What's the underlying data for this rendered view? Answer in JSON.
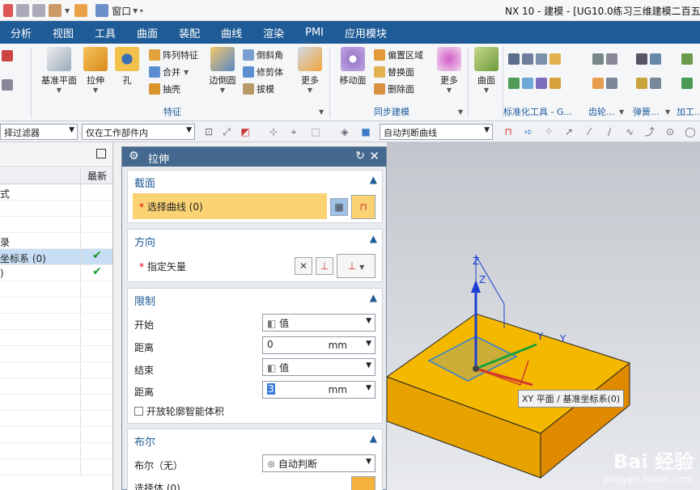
{
  "window": {
    "title": "NX 10 - 建模 - [UG10.0练习三维建模二百五"
  },
  "quick_access": {
    "window_menu": "窗口"
  },
  "menu": [
    "分析",
    "视图",
    "工具",
    "曲面",
    "装配",
    "曲线",
    "渲染",
    "PMI",
    "应用模块"
  ],
  "ribbon": {
    "datum_plane": "基准平面",
    "extrude": "拉伸",
    "hole": "孔",
    "array_feature": "阵列特征",
    "unite": "合并",
    "shell": "抽壳",
    "edge_blend": "边倒圆",
    "chamfer": "倒斜角",
    "trim_body": "修剪体",
    "draft": "拔模",
    "more1": "更多",
    "group_feature": "特征",
    "move_face": "移动面",
    "offset_region": "偏置区域",
    "replace_face": "替换面",
    "delete_face": "删除面",
    "more2": "更多",
    "group_sync": "同步建模",
    "surface": "曲面",
    "group_standard": "标准化工具 - G...",
    "group_gear": "齿轮...",
    "group_spring": "弹簧...",
    "group_machining": "加工..."
  },
  "toolbar2": {
    "filter": "择过滤器",
    "scope": "仅在工作部件内",
    "curve_rule": "自动判断曲线"
  },
  "navigator": {
    "col_latest": "最新",
    "rows": [
      {
        "label": "式",
        "check": ""
      },
      {
        "label": "",
        "check": ""
      },
      {
        "label": "",
        "check": ""
      },
      {
        "label": "录",
        "check": ""
      },
      {
        "label": "坐标系 (0)",
        "check": "✔",
        "selected": true
      },
      {
        "label": ")",
        "check": "✔"
      }
    ]
  },
  "dialog": {
    "title": "拉伸",
    "section": {
      "header": "截面",
      "select_curve": "选择曲线 (0)"
    },
    "direction": {
      "header": "方向",
      "specify_vector": "指定矢量"
    },
    "limits": {
      "header": "限制",
      "start_label": "开始",
      "start_value": "值",
      "distance1_label": "距离",
      "distance1_value": "0",
      "end_label": "结束",
      "end_value": "值",
      "distance2_label": "距离",
      "distance2_value": "3",
      "unit": "mm",
      "open_profile": "开放轮廓智能体积"
    },
    "boolean": {
      "header": "布尔",
      "boolean_label": "布尔（无）",
      "boolean_value": "自动判断",
      "select_body": "选择体 (0)"
    }
  },
  "viewport": {
    "tooltip": "XY 平面 / 基准坐标系(0)",
    "axis_z": "Z",
    "axis_y": "Y",
    "watermark_brand": "Bai 经验",
    "watermark_url": "jingyan.baidu.com",
    "colors": {
      "block": "#f5b800",
      "block_side": "#e08a00",
      "plane": "#2a7fd4"
    }
  }
}
